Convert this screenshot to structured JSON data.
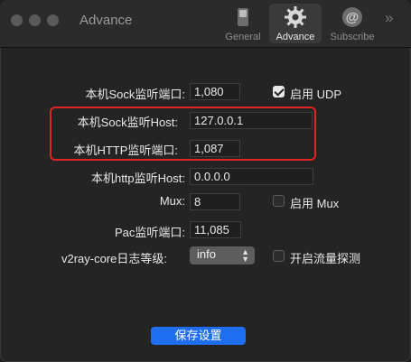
{
  "window": {
    "title": "Advance"
  },
  "toolbar": {
    "items": [
      {
        "label": "General",
        "icon": "switch-icon"
      },
      {
        "label": "Advance",
        "icon": "gear-icon"
      },
      {
        "label": "Subscribe",
        "icon": "at-icon"
      }
    ],
    "more": "»"
  },
  "form": {
    "sock_port_label": "本机Sock监听端口:",
    "sock_port_value": "1,080",
    "udp_label": "启用 UDP",
    "sock_host_label": "本机Sock监听Host:",
    "sock_host_value": "127.0.0.1",
    "http_port_label": "本机HTTP监听端口:",
    "http_port_value": "1,087",
    "http_host_label": "本机http监听Host:",
    "http_host_value": "0.0.0.0",
    "mux_label": "Mux:",
    "mux_value": "8",
    "mux_enable_label": "启用 Mux",
    "pac_port_label": "Pac监听端口:",
    "pac_port_value": "11,085",
    "log_level_label": "v2ray-core日志等级:",
    "log_level_value": "info",
    "sniffing_label": "开启流量探测"
  },
  "checkboxes": {
    "udp": true,
    "mux": false,
    "sniffing": false
  },
  "save_button": "保存设置",
  "colors": {
    "accent": "#1f6ef0",
    "highlight": "#e02424"
  }
}
